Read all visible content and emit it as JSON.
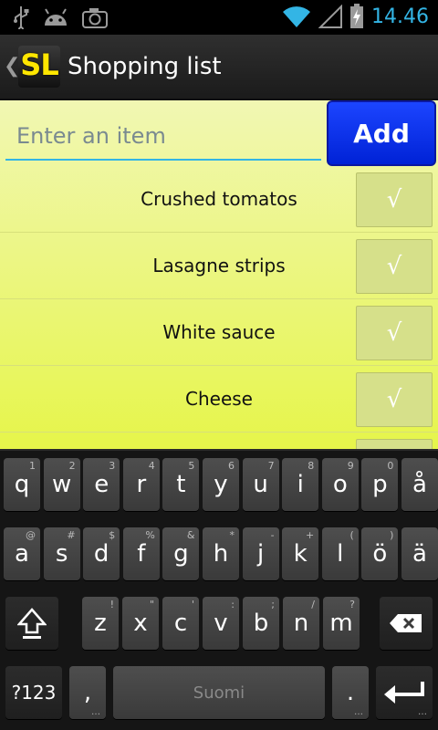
{
  "status_bar": {
    "time": "14.46",
    "icons": [
      "usb-icon",
      "android-icon",
      "camera-icon",
      "wifi-icon",
      "signal-icon",
      "battery-charging-icon"
    ]
  },
  "action_bar": {
    "logo_text": "SL",
    "title": "Shopping list"
  },
  "entry": {
    "placeholder": "Enter an item",
    "value": "",
    "add_label": "Add"
  },
  "items": [
    {
      "label": "Crushed tomatos",
      "check": "√"
    },
    {
      "label": "Lasagne strips",
      "check": "√"
    },
    {
      "label": "White sauce",
      "check": "√"
    },
    {
      "label": "Cheese",
      "check": "√"
    }
  ],
  "keyboard": {
    "row1": [
      {
        "k": "q",
        "h": "1"
      },
      {
        "k": "w",
        "h": "2"
      },
      {
        "k": "e",
        "h": "3"
      },
      {
        "k": "r",
        "h": "4"
      },
      {
        "k": "t",
        "h": "5"
      },
      {
        "k": "y",
        "h": "6"
      },
      {
        "k": "u",
        "h": "7"
      },
      {
        "k": "i",
        "h": "8"
      },
      {
        "k": "o",
        "h": "9"
      },
      {
        "k": "p",
        "h": "0"
      },
      {
        "k": "å",
        "h": ""
      }
    ],
    "row2": [
      {
        "k": "a",
        "h": "@"
      },
      {
        "k": "s",
        "h": "#"
      },
      {
        "k": "d",
        "h": "$"
      },
      {
        "k": "f",
        "h": "%"
      },
      {
        "k": "g",
        "h": "&"
      },
      {
        "k": "h",
        "h": "*"
      },
      {
        "k": "j",
        "h": "-"
      },
      {
        "k": "k",
        "h": "+"
      },
      {
        "k": "l",
        "h": "("
      },
      {
        "k": "ö",
        "h": ")"
      },
      {
        "k": "ä",
        "h": ""
      }
    ],
    "row3": [
      {
        "k": "z",
        "h": "!"
      },
      {
        "k": "x",
        "h": "\""
      },
      {
        "k": "c",
        "h": "'"
      },
      {
        "k": "v",
        "h": ":"
      },
      {
        "k": "b",
        "h": ";"
      },
      {
        "k": "n",
        "h": "/"
      },
      {
        "k": "m",
        "h": "?"
      }
    ],
    "symbols_label": "?123",
    "comma_label": ",",
    "space_label": "Suomi",
    "period_label": ".",
    "more_dots": "…"
  }
}
